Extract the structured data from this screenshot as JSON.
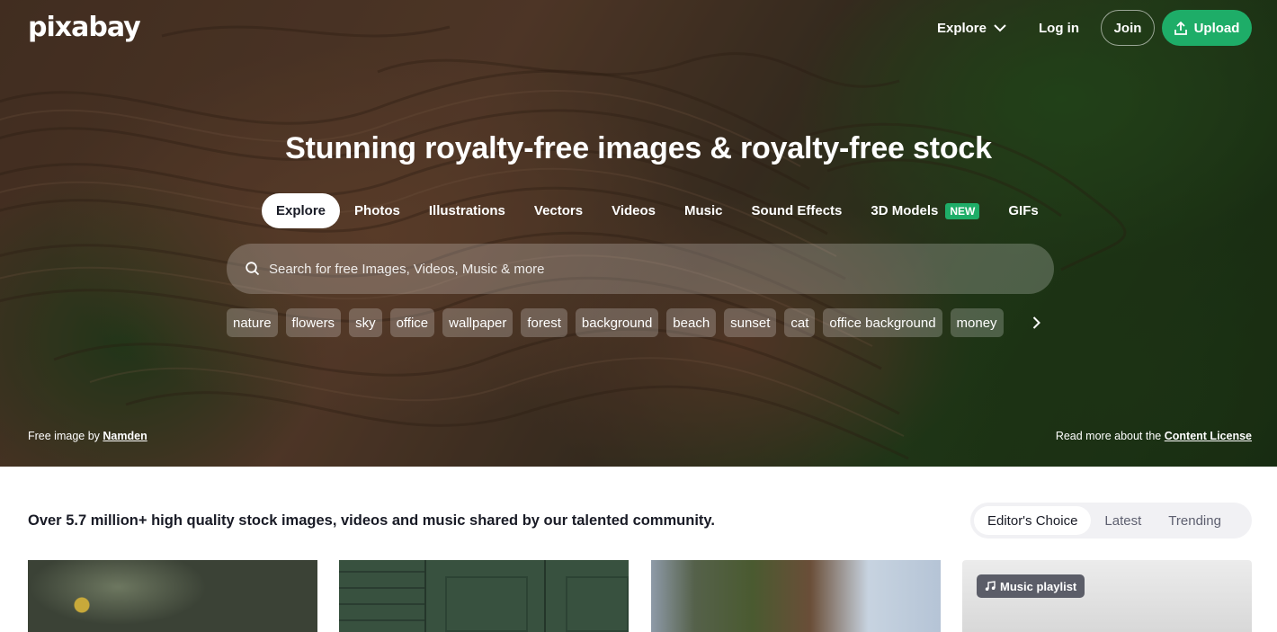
{
  "brand": {
    "logo_text": "pixabay"
  },
  "topnav": {
    "explore_label": "Explore",
    "login_label": "Log in",
    "join_label": "Join",
    "upload_label": "Upload"
  },
  "hero": {
    "headline": "Stunning royalty-free images & royalty-free stock",
    "tabs": [
      {
        "label": "Explore",
        "active": true
      },
      {
        "label": "Photos"
      },
      {
        "label": "Illustrations"
      },
      {
        "label": "Vectors"
      },
      {
        "label": "Videos"
      },
      {
        "label": "Music"
      },
      {
        "label": "Sound Effects"
      },
      {
        "label": "3D Models",
        "badge": "NEW"
      },
      {
        "label": "GIFs"
      }
    ],
    "search": {
      "placeholder": "Search for free Images, Videos, Music & more",
      "value": ""
    },
    "chips": [
      "nature",
      "flowers",
      "sky",
      "office",
      "wallpaper",
      "forest",
      "background",
      "beach",
      "sunset",
      "cat",
      "office background",
      "money"
    ],
    "credit": {
      "prefix": "Free image by",
      "author": "Namden"
    },
    "license": {
      "prefix": "Read more about the",
      "link": "Content License"
    }
  },
  "main": {
    "tagline": "Over 5.7 million+ high quality stock images, videos and music shared by our talented community.",
    "filters": [
      {
        "label": "Editor's Choice",
        "active": true
      },
      {
        "label": "Latest"
      },
      {
        "label": "Trending"
      }
    ],
    "playlist_badge": "Music playlist"
  },
  "colors": {
    "accent": "#1ead68",
    "text": "#191b26"
  },
  "icons": {
    "search": "search-icon",
    "chevron": "chevron-down-icon",
    "upload": "upload-icon",
    "music": "music-note-icon",
    "next": "chevron-right-icon"
  }
}
